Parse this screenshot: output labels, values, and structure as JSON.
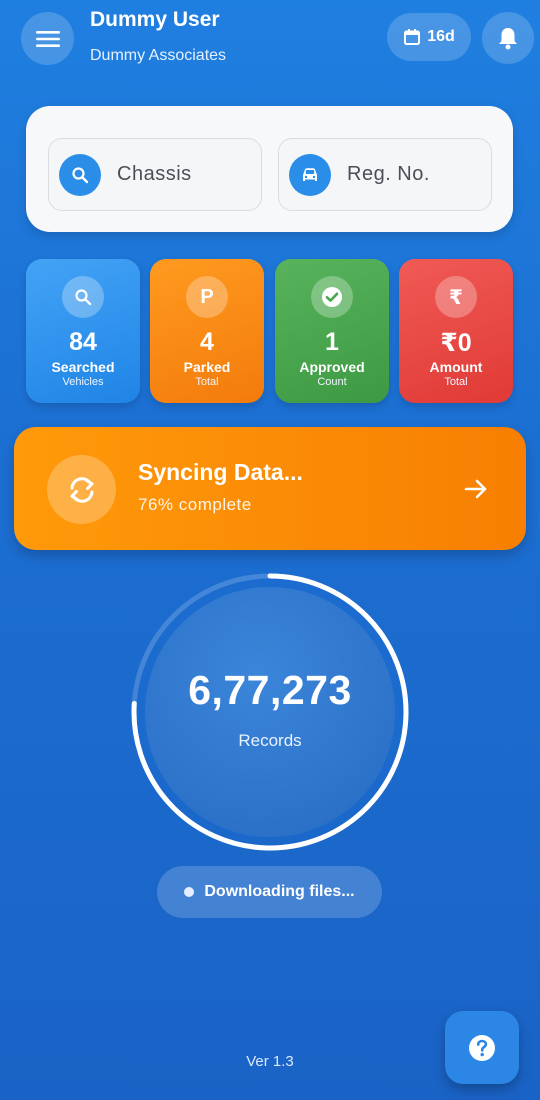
{
  "header": {
    "user_name": "Dummy User",
    "organization": "Dummy Associates",
    "days_badge": "16d",
    "menu_icon": "hamburger-menu-icon",
    "calendar_icon": "calendar-icon",
    "bell_icon": "bell-icon"
  },
  "search": {
    "chassis_label": "Chassis",
    "reg_label": "Reg. No."
  },
  "stats": [
    {
      "icon_glyph": "",
      "value": "84",
      "label": "Searched",
      "sub": "Vehicles",
      "color": "#2f92ee"
    },
    {
      "icon_glyph": "P",
      "value": "4",
      "label": "Parked",
      "sub": "Total",
      "color": "#f5870f"
    },
    {
      "icon_glyph": "",
      "value": "1",
      "label": "Approved",
      "sub": "Count",
      "color": "#4aa74f"
    },
    {
      "icon_glyph": "₹",
      "value": "₹0",
      "label": "Amount",
      "sub": "Total",
      "color": "#e84844"
    }
  ],
  "sync": {
    "title": "Syncing Data...",
    "subtitle": "76% complete",
    "progress": 0.76
  },
  "records": {
    "count": "6,77,273",
    "label": "Records"
  },
  "download": {
    "status": "Downloading files..."
  },
  "footer": {
    "version": "Ver 1.3"
  }
}
